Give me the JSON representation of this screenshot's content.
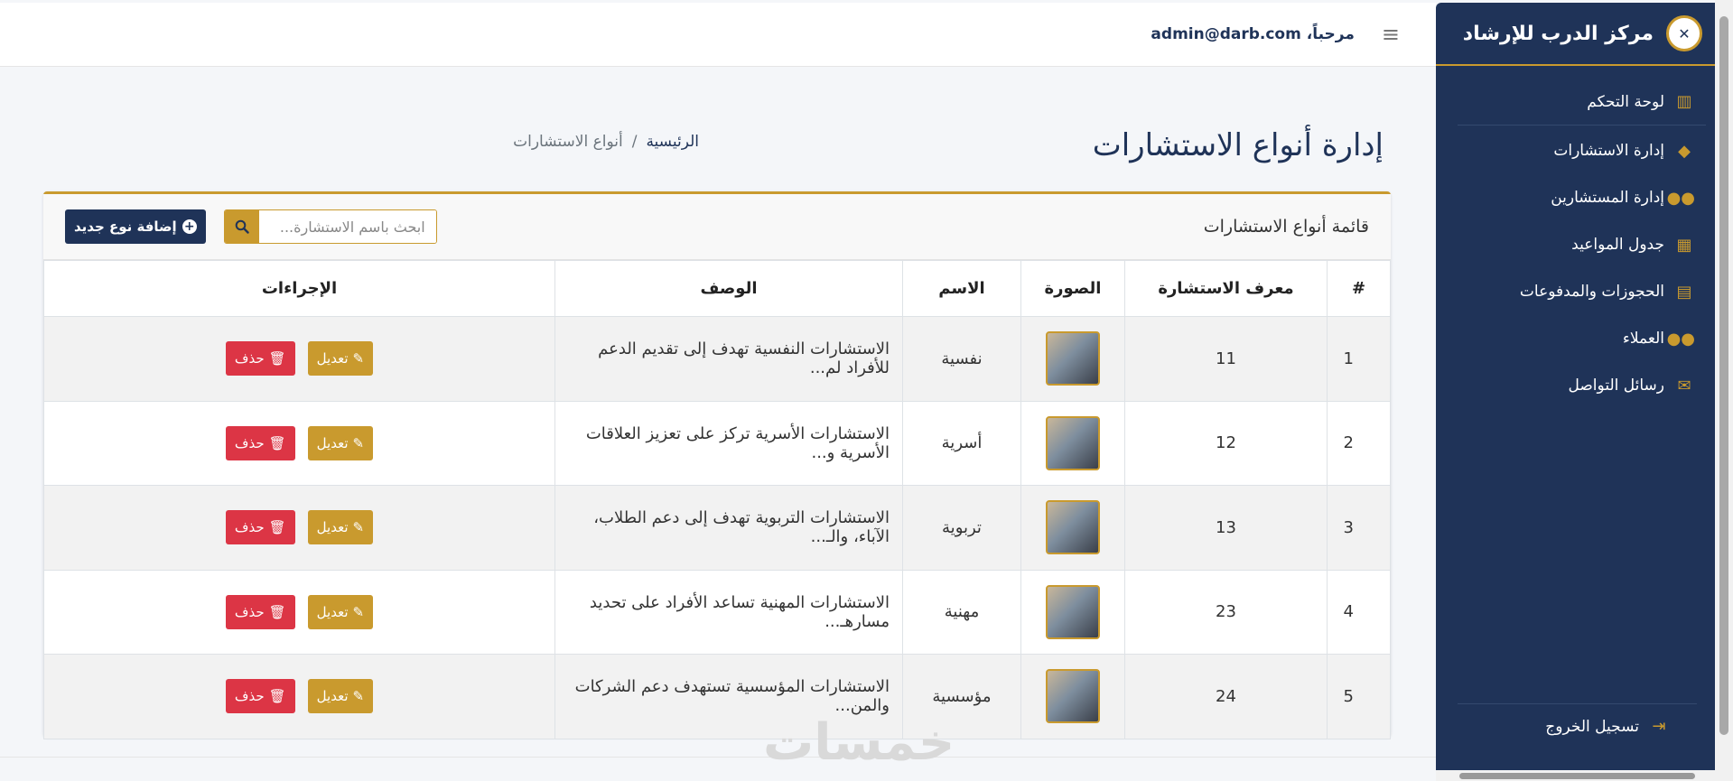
{
  "sidebar": {
    "brand": "مركز الدرب للإرشاد",
    "items": [
      {
        "label": "لوحة التحكم",
        "icon": "chart-icon"
      },
      {
        "label": "إدارة الاستشارات",
        "icon": "tags-icon"
      },
      {
        "label": "إدارة المستشارين",
        "icon": "users-icon"
      },
      {
        "label": "جدول المواعيد",
        "icon": "calendar-icon"
      },
      {
        "label": "الحجوزات والمدفوعات",
        "icon": "clipboard-icon"
      },
      {
        "label": "العملاء",
        "icon": "user-group-icon"
      },
      {
        "label": "رسائل التواصل",
        "icon": "envelope-icon"
      }
    ],
    "logout": "تسجيل الخروج"
  },
  "topbar": {
    "welcome": "مرحباً، admin@darb.com"
  },
  "page": {
    "title": "إدارة أنواع الاستشارات",
    "breadcrumb_home": "الرئيسية",
    "breadcrumb_sep": "/",
    "breadcrumb_current": "أنواع الاستشارات"
  },
  "card": {
    "title": "قائمة أنواع الاستشارات",
    "search_placeholder": "ابحث باسم الاستشارة...",
    "add_label": "إضافة نوع جديد"
  },
  "table": {
    "headers": [
      "#",
      "معرف الاستشارة",
      "الصورة",
      "الاسم",
      "الوصف",
      "الإجراءات"
    ],
    "edit_label": "تعديل",
    "delete_label": "حذف",
    "rows": [
      {
        "num": "1",
        "id": "11",
        "name": "نفسية",
        "desc": "الاستشارات النفسية تهدف إلى تقديم الدعم للأفراد لم..."
      },
      {
        "num": "2",
        "id": "12",
        "name": "أسرية",
        "desc": "الاستشارات الأسرية تركز على تعزيز العلاقات الأسرية و..."
      },
      {
        "num": "3",
        "id": "13",
        "name": "تربوية",
        "desc": "الاستشارات التربوية تهدف إلى دعم الطلاب، الآباء، والـ..."
      },
      {
        "num": "4",
        "id": "23",
        "name": "مهنية",
        "desc": "الاستشارات المهنية تساعد الأفراد على تحديد مسارهـ..."
      },
      {
        "num": "5",
        "id": "24",
        "name": "مؤسسية",
        "desc": "الاستشارات المؤسسية تستهدف دعم الشركات والمن..."
      }
    ]
  },
  "watermark": "خمسات",
  "colors": {
    "primary": "#1f3358",
    "accent": "#c99a2e",
    "danger": "#dc3545"
  }
}
